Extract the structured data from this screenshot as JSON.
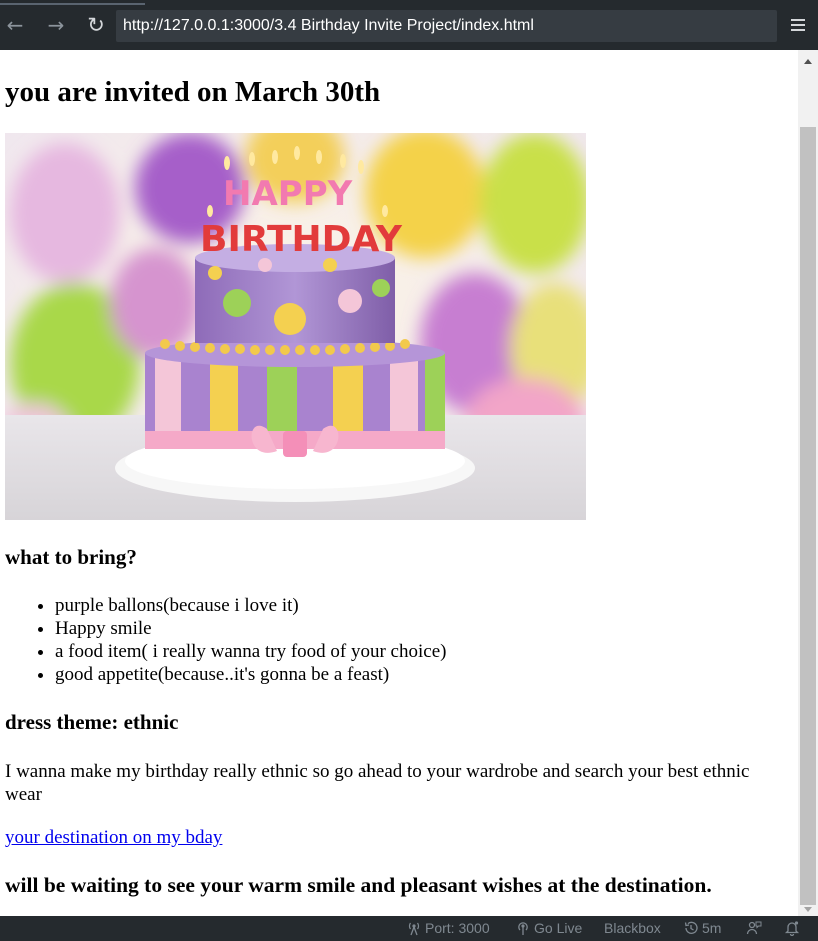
{
  "browser": {
    "back_icon": "arrow-left-icon",
    "forward_icon": "arrow-right-icon",
    "reload_icon": "reload-icon",
    "url": "http://127.0.0.1:3000/3.4 Birthday Invite Project/index.html",
    "menu_icon": "hamburger-menu-icon"
  },
  "page": {
    "title": "you are invited on March 30th",
    "image_text_top": "HAPPY",
    "image_text_bottom": "BIRTHDAY",
    "bring_heading": "what to bring?",
    "bring_items": [
      "purple ballons(because i love it)",
      "Happy smile",
      "a food item( i really wanna try food of your choice)",
      "good appetite(because..it's gonna be a feast)"
    ],
    "dress_heading": "dress theme: ethnic",
    "dress_text": "I wanna make my birthday really ethnic so go ahead to your wardrobe and search your best ethnic wear",
    "destination_link": "your destination on my bday",
    "closing": "will be waiting to see your warm smile and pleasant wishes at the destination."
  },
  "statusbar": {
    "port": "Port: 3000",
    "go_live": "Go Live",
    "blackbox": "Blackbox",
    "timer": "5m"
  },
  "colors": {
    "toolbar_bg": "#252a2e",
    "url_bar_bg": "#363c42",
    "link": "#0000ee",
    "scroll_thumb": "#c1c1c1"
  }
}
